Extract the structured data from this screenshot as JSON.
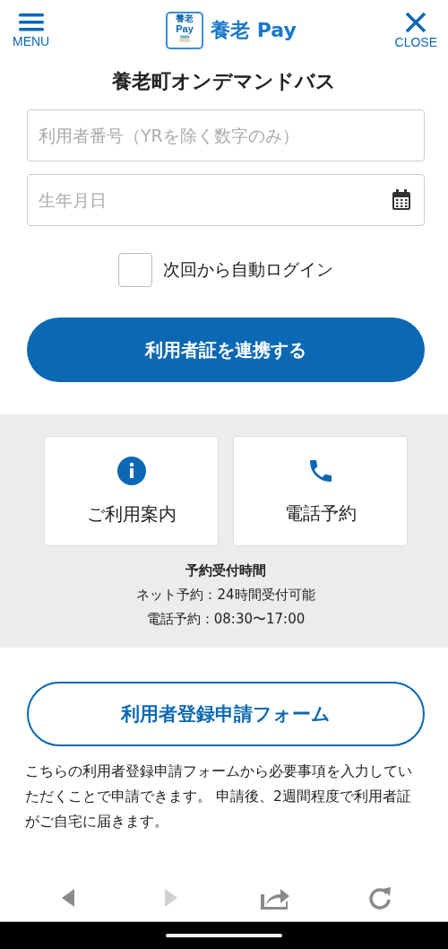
{
  "header": {
    "menu_label": "MENU",
    "logo_badge_top": "養老",
    "logo_badge_bottom": "Pay",
    "logo_text": "養老 Pay",
    "close_label": "CLOSE"
  },
  "title": "養老町オンデマンドバス",
  "form": {
    "user_number": {
      "placeholder": "利用者番号（YRを除く数字のみ）"
    },
    "birthdate": {
      "placeholder": "生年月日"
    },
    "auto_login": {
      "label": "次回から自動ログイン",
      "checked": false
    },
    "submit": "利用者証を連携する"
  },
  "info": {
    "cards": [
      {
        "kind": "info",
        "label": "ご利用案内"
      },
      {
        "kind": "phone",
        "label": "電話予約"
      }
    ],
    "hours_title": "予約受付時間",
    "hours": [
      "ネット予約：24時間受付可能",
      "電話予約：08:30〜17:00"
    ]
  },
  "registration": {
    "button": "利用者登録申請フォーム",
    "description": "こちらの利用者登録申請フォームから必要事項を入力していただくことで申請できます。 申請後、2週間程度で利用者証がご自宅に届きます。"
  },
  "browser_bar": [
    {
      "kind": "back",
      "disabled": false
    },
    {
      "kind": "forward",
      "disabled": true
    },
    {
      "kind": "share",
      "disabled": false
    },
    {
      "kind": "reload",
      "disabled": false
    }
  ]
}
